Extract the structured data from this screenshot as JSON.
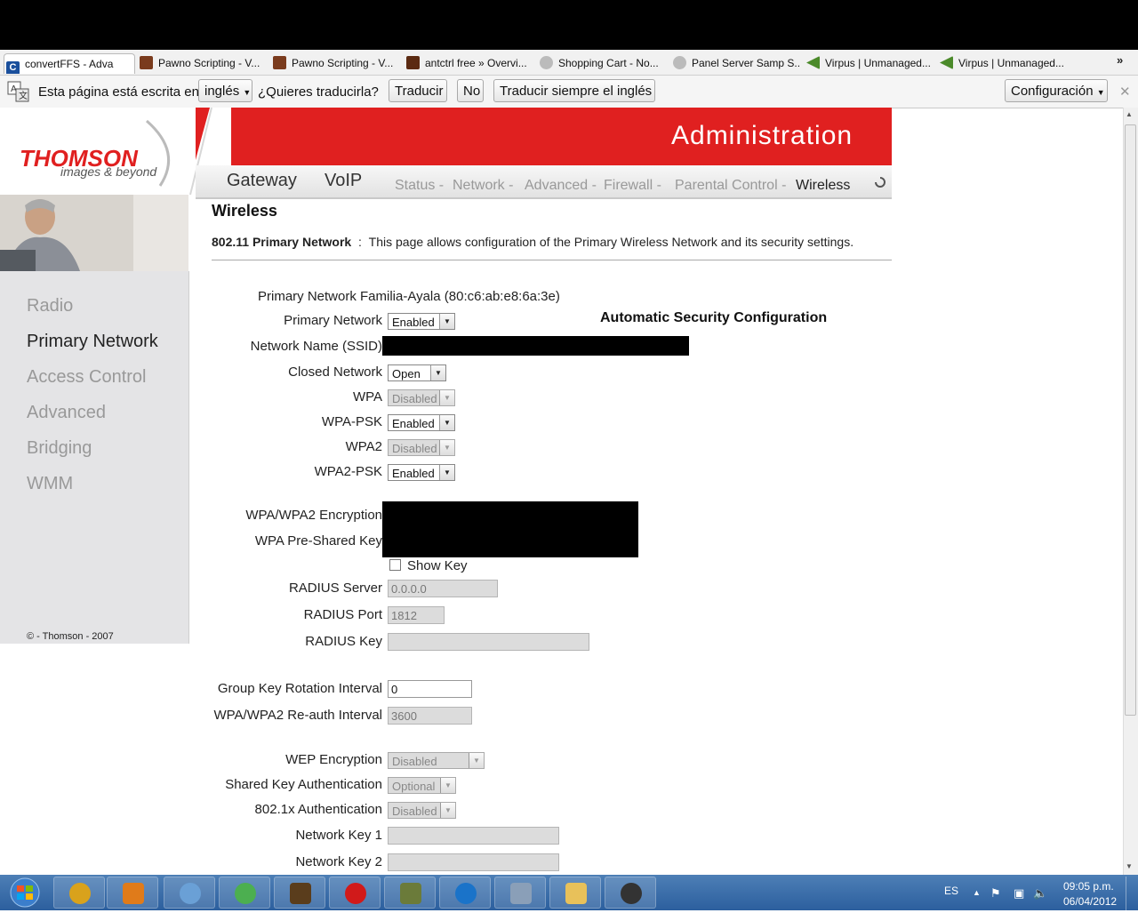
{
  "browser": {
    "tabs": [
      {
        "title": "convertFFS - Adva",
        "icon": "letter-c-icon",
        "color": "#1a4f9c"
      },
      {
        "title": "Pawno Scripting - V...",
        "icon": "forum-icon",
        "color": "#7a3b1d"
      },
      {
        "title": "Pawno Scripting - V...",
        "icon": "forum-icon",
        "color": "#7a3b1d"
      },
      {
        "title": "antctrl free » Overvi...",
        "icon": "forum-icon",
        "color": "#5b2a12"
      },
      {
        "title": "Shopping Cart - No...",
        "icon": "globe-icon",
        "color": "#888888"
      },
      {
        "title": "Panel Server Samp S...",
        "icon": "globe-icon",
        "color": "#888888"
      },
      {
        "title": "Virpus | Unmanaged...",
        "icon": "leaf-icon",
        "color": "#4b8a2a"
      },
      {
        "title": "Virpus | Unmanaged...",
        "icon": "leaf-icon",
        "color": "#4b8a2a"
      }
    ],
    "more_tabs": "»"
  },
  "translate_bar": {
    "prefix": "Esta página está escrita en",
    "language": "inglés",
    "question": "¿Quieres traducirla?",
    "translate": "Traducir",
    "no": "No",
    "always": "Traducir siempre el inglés",
    "settings": "Configuración",
    "close": "✕"
  },
  "router": {
    "brand": "THOMSON",
    "tagline": "images & beyond",
    "header_title": "Administration",
    "main_nav": [
      "Gateway",
      "VoIP"
    ],
    "sub_nav": [
      "Status -",
      "Network -",
      "Advanced -",
      "Firewall -",
      "Parental Control -",
      "Wireless"
    ],
    "sidebar": [
      "Radio",
      "Primary Network",
      "Access Control",
      "Advanced",
      "Bridging",
      "WMM"
    ],
    "copyright": "© - Thomson - 2007",
    "page_title": "Wireless",
    "desc_strong": "802.11 Primary Network",
    "desc_sep": ":",
    "desc_text": "This page allows configuration of the Primary Wireless Network and its security settings.",
    "network_line": "Primary Network Familia-Ayala (80:c6:ab:e8:6a:3e)",
    "auto_security": "Automatic Security Configuration",
    "fields": {
      "primary_network": {
        "label": "Primary Network",
        "value": "Enabled"
      },
      "ssid": {
        "label": "Network Name (SSID)"
      },
      "closed_network": {
        "label": "Closed Network",
        "value": "Open"
      },
      "wpa": {
        "label": "WPA",
        "value": "Disabled"
      },
      "wpa_psk": {
        "label": "WPA-PSK",
        "value": "Enabled"
      },
      "wpa2": {
        "label": "WPA2",
        "value": "Disabled"
      },
      "wpa2_psk": {
        "label": "WPA2-PSK",
        "value": "Enabled"
      },
      "encryption": {
        "label": "WPA/WPA2 Encryption"
      },
      "psk": {
        "label": "WPA Pre-Shared Key"
      },
      "show_key": {
        "label": "Show Key"
      },
      "radius_server": {
        "label": "RADIUS Server",
        "value": "0.0.0.0"
      },
      "radius_port": {
        "label": "RADIUS Port",
        "value": "1812"
      },
      "radius_key": {
        "label": "RADIUS Key",
        "value": ""
      },
      "group_key": {
        "label": "Group Key Rotation Interval",
        "value": "0"
      },
      "reauth": {
        "label": "WPA/WPA2 Re-auth Interval",
        "value": "3600"
      },
      "wep": {
        "label": "WEP Encryption",
        "value": "Disabled"
      },
      "shared_key_auth": {
        "label": "Shared Key Authentication",
        "value": "Optional"
      },
      "dot1x": {
        "label": "802.1x Authentication",
        "value": "Disabled"
      },
      "netkey1": {
        "label": "Network Key 1",
        "value": ""
      },
      "netkey2": {
        "label": "Network Key 2",
        "value": ""
      }
    }
  },
  "taskbar": {
    "lang": "ES",
    "time": "09:05 p.m.",
    "date": "06/04/2012",
    "apps": [
      {
        "icon": "chrome-icon",
        "color": "#d9a21c"
      },
      {
        "icon": "media-player-icon",
        "color": "#e07b1a"
      },
      {
        "icon": "users-icon",
        "color": "#6aa0d6"
      },
      {
        "icon": "network-globe-icon",
        "color": "#4caf50"
      },
      {
        "icon": "game-icon",
        "color": "#5a3d1c"
      },
      {
        "icon": "opera-icon",
        "color": "#d11a1a"
      },
      {
        "icon": "soldier-icon",
        "color": "#6b7b3a"
      },
      {
        "icon": "teamviewer-icon",
        "color": "#1a73c9"
      },
      {
        "icon": "network-lock-icon",
        "color": "#8a9fb8"
      },
      {
        "icon": "folder-icon",
        "color": "#e8c15a"
      },
      {
        "icon": "spy-icon",
        "color": "#333333"
      }
    ]
  }
}
